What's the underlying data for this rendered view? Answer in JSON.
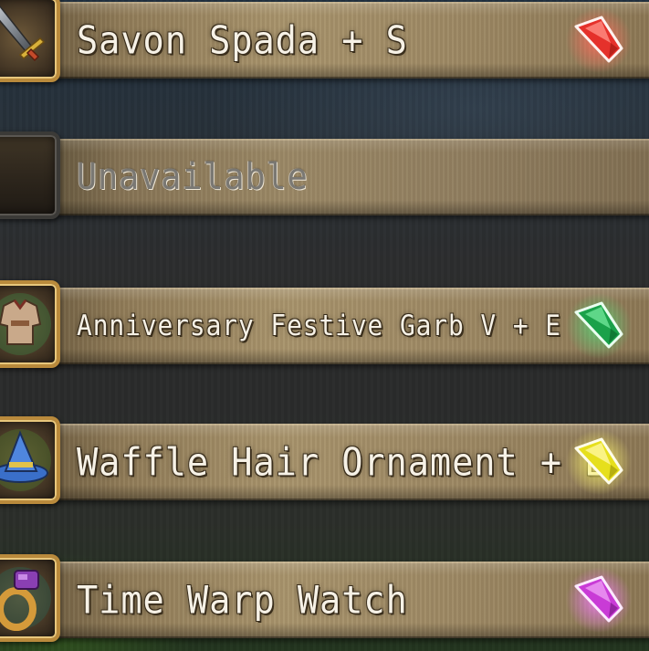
{
  "equipment_slots": [
    {
      "item_name": "Savon Spada + S",
      "available": true,
      "item_icon": "sword-icon",
      "rarity_gem": {
        "icon": "rarity-gem-icon",
        "color": "#e5312b",
        "glow": "#ff6a5a"
      }
    },
    {
      "item_name": "Unavailable",
      "available": false,
      "item_icon": "empty-slot",
      "rarity_gem": null
    },
    {
      "item_name": "Anniversary Festive Garb V + E",
      "available": true,
      "item_icon": "armor-icon",
      "rarity_gem": {
        "icon": "rarity-gem-icon",
        "color": "#1aa14a",
        "glow": "#4fe07a"
      }
    },
    {
      "item_name": "Waffle Hair Ornament + E",
      "available": true,
      "item_icon": "hat-icon",
      "rarity_gem": {
        "icon": "rarity-gem-icon",
        "color": "#e6df1c",
        "glow": "#fff66a"
      }
    },
    {
      "item_name": "Time Warp Watch",
      "available": true,
      "item_icon": "ring-icon",
      "rarity_gem": {
        "icon": "rarity-gem-icon",
        "color": "#c93bd6",
        "glow": "#f27af7"
      }
    }
  ]
}
